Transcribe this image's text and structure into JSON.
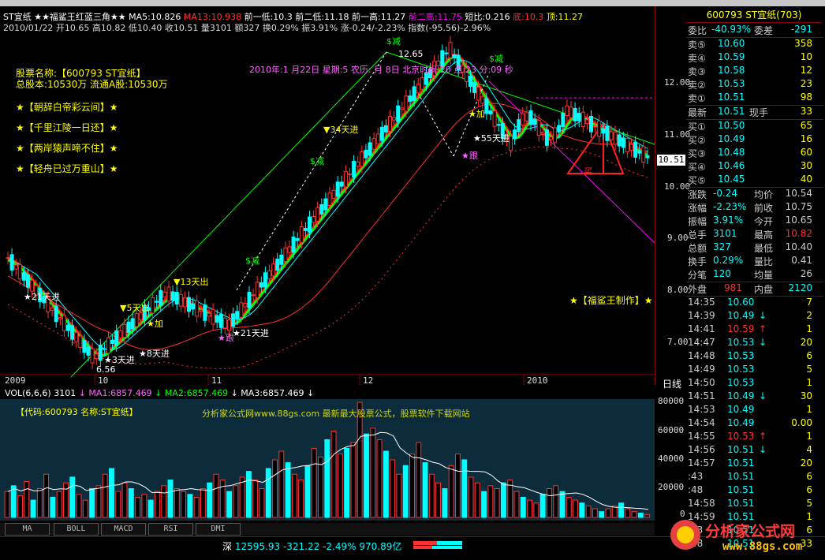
{
  "header": {
    "line1": {
      "stock": "ST宜纸",
      "title": "★★福鲨王红蓝三角★★",
      "ma5": "MA5:10.826",
      "ma13": "MA13:10.938",
      "prev_low1": "前一低:10.3",
      "prev_low2": "前二低:11.18",
      "prev_high1": "前一高:11.27",
      "prev_high2": "前二高:11.75",
      "short_ratio": "短比:0.216",
      "bottom": "底:10.3",
      "top": "顶:11.27"
    },
    "line2": "2010/01/22 开10.65 高10.82 低10.40 收10.51 量3101 额327 换0.29% 振3.91% 涨-0.24/-2.23% 指数(-95.56)-2.96%"
  },
  "info_box": {
    "name": "股票名称:【600793 ST宜纸】",
    "capital": "总股本:10530万  流通A股:10530万",
    "poems": [
      "★【朝辞白帝彩云间】★",
      "★【千里江陵一日还】★",
      "★【两岸猿声啼不住】★",
      "★【轻舟已过万重山】★"
    ]
  },
  "timestamp_text": "2010年:1 月22日 星期:5 农历:  月 8日 北京时间:20 点:23 分:09 秒",
  "maker": "★【福鲨王制作】★",
  "price_axis": [
    "12.00",
    "11.00",
    "10.00",
    "9.00",
    "8.00",
    "7.00"
  ],
  "current_price_tag": "10.51",
  "x_axis": [
    "2009",
    "10",
    "11",
    "12",
    "2010"
  ],
  "period_label": "日线",
  "annotations": {
    "peak": "12.65",
    "low": "6.56",
    "sig1": "34天进",
    "sig2": "13天出",
    "sig3": "5天出",
    "sig4": "21天进",
    "sig5": "8天进",
    "sig6": "3天进",
    "sig7": "21天进",
    "sig8": "55天进",
    "jian": "$减",
    "jia": "加",
    "gen": "跟",
    "mai": "买"
  },
  "volume": {
    "header_label": "VOL(6,6,6)",
    "header_value": "3101",
    "ma1": "MA1:6857.469",
    "ma2": "MA2:6857.469",
    "ma3": "MA3:6857.469",
    "code_name": "【代码:600793 名称:ST宜纸】",
    "watermark": "分析家公式网www.88gs.com 最新最大股票公式，股票软件下载网站",
    "axis": [
      "80000",
      "60000",
      "40000",
      "20000",
      "0"
    ],
    "bars": [
      18,
      22,
      15,
      25,
      12,
      20,
      30,
      14,
      18,
      24,
      28,
      16,
      12,
      20,
      22,
      30,
      34,
      18,
      24,
      20,
      14,
      16,
      12,
      18,
      22,
      26,
      20,
      18,
      16,
      14,
      20,
      24,
      30,
      26,
      18,
      22,
      28,
      32,
      26,
      20,
      34,
      40,
      46,
      38,
      30,
      26,
      36,
      48,
      42,
      54,
      60,
      44,
      48,
      52,
      80,
      58,
      62,
      54,
      46,
      40,
      30,
      36,
      44,
      52,
      38,
      30,
      24,
      20,
      36,
      44,
      40,
      28,
      24,
      18,
      22,
      20,
      24,
      26,
      18,
      14,
      12,
      10,
      16,
      20,
      22,
      18,
      14,
      12,
      10,
      8,
      6,
      4,
      6,
      8,
      10,
      6,
      4,
      3,
      2
    ]
  },
  "tabs": [
    "MA",
    "BOLL",
    "MACD",
    "RSI",
    "DMI"
  ],
  "status": {
    "market": "深",
    "index": "12595.93",
    "change": "-321.22",
    "pct": "-2.49%",
    "amount": "970.89亿"
  },
  "right_panel": {
    "title": "600793 ST宜纸(703)",
    "committee": {
      "label": "委比",
      "value": "-40.93%",
      "label2": "委差",
      "value2": "-291"
    },
    "sells": [
      {
        "label": "卖⑤",
        "price": "10.60",
        "vol": "358"
      },
      {
        "label": "卖④",
        "price": "10.59",
        "vol": "10"
      },
      {
        "label": "卖③",
        "price": "10.58",
        "vol": "12"
      },
      {
        "label": "卖②",
        "price": "10.53",
        "vol": "23"
      },
      {
        "label": "卖①",
        "price": "10.51",
        "vol": "98"
      }
    ],
    "latest": {
      "label": "最新",
      "price": "10.51",
      "label2": "现手",
      "vol": "33"
    },
    "buys": [
      {
        "label": "买①",
        "price": "10.50",
        "vol": "65"
      },
      {
        "label": "买②",
        "price": "10.49",
        "vol": "16"
      },
      {
        "label": "买③",
        "price": "10.48",
        "vol": "60"
      },
      {
        "label": "买④",
        "price": "10.46",
        "vol": "30"
      },
      {
        "label": "买⑤",
        "price": "10.45",
        "vol": "40"
      }
    ],
    "stats": [
      {
        "l1": "涨跌",
        "v1": "-0.24",
        "l2": "均价",
        "v2": "10.54"
      },
      {
        "l1": "涨幅",
        "v1": "-2.23%",
        "l2": "前收",
        "v2": "10.75"
      },
      {
        "l1": "振幅",
        "v1": "3.91%",
        "l2": "今开",
        "v2": "10.65"
      },
      {
        "l1": "总手",
        "v1": "3101",
        "l2": "最高",
        "v2": "10.82"
      },
      {
        "l1": "总额",
        "v1": "327",
        "l2": "最低",
        "v2": "10.40"
      },
      {
        "l1": "换手",
        "v1": "0.29%",
        "l2": "量比",
        "v2": "0.41"
      },
      {
        "l1": "分笔",
        "v1": "120",
        "l2": "均量",
        "v2": "26"
      }
    ],
    "outer": {
      "l1": "外盘",
      "v1": "981",
      "l2": "内盘",
      "v2": "2120"
    },
    "ticks": [
      {
        "t": "14:35",
        "p": "10.60",
        "a": "",
        "v": "7"
      },
      {
        "t": "14:39",
        "p": "10.49",
        "a": "↓",
        "v": "2"
      },
      {
        "t": "14:41",
        "p": "10.59",
        "a": "↑",
        "v": "1"
      },
      {
        "t": "14:47",
        "p": "10.53",
        "a": "↓",
        "v": "20"
      },
      {
        "t": "14:48",
        "p": "10.53",
        "a": "",
        "v": "6"
      },
      {
        "t": "14:49",
        "p": "10.53",
        "a": "",
        "v": "5"
      },
      {
        "t": "14:50",
        "p": "10.53",
        "a": "",
        "v": "1"
      },
      {
        "t": "14:51",
        "p": "10.49",
        "a": "↓",
        "v": "30"
      },
      {
        "t": "14:53",
        "p": "10.49",
        "a": "",
        "v": "1"
      },
      {
        "t": "14:54",
        "p": "10.49",
        "a": "",
        "v": "0.00"
      },
      {
        "t": "14:55",
        "p": "10.53",
        "a": "↑",
        "v": "1"
      },
      {
        "t": "14:56",
        "p": "10.51",
        "a": "↓",
        "v": "4"
      },
      {
        "t": "14:57",
        "p": "10.51",
        "a": "",
        "v": "20"
      },
      {
        "t": ":43",
        "p": "10.51",
        "a": "",
        "v": "6"
      },
      {
        "t": ":48",
        "p": "10.51",
        "a": "",
        "v": "6"
      },
      {
        "t": "14:58",
        "p": "10.51",
        "a": "",
        "v": "5"
      },
      {
        "t": "14:59",
        "p": "10.51",
        "a": "",
        "v": "1"
      },
      {
        "t": ":33",
        "p": "10.51",
        "a": "",
        "v": "6"
      },
      {
        "t": ":48",
        "p": "10.51",
        "a": "",
        "v": "33"
      }
    ]
  },
  "logo": {
    "text": "分析家公式网",
    "url": "www.88gs.com"
  },
  "colors": {
    "up": "#ff3030",
    "down": "#00ffff",
    "ma5": "#ff0000",
    "ma13": "#00ff00",
    "text": "#c0c0c0",
    "yellow": "#ffff00",
    "magenta": "#ff00ff"
  }
}
